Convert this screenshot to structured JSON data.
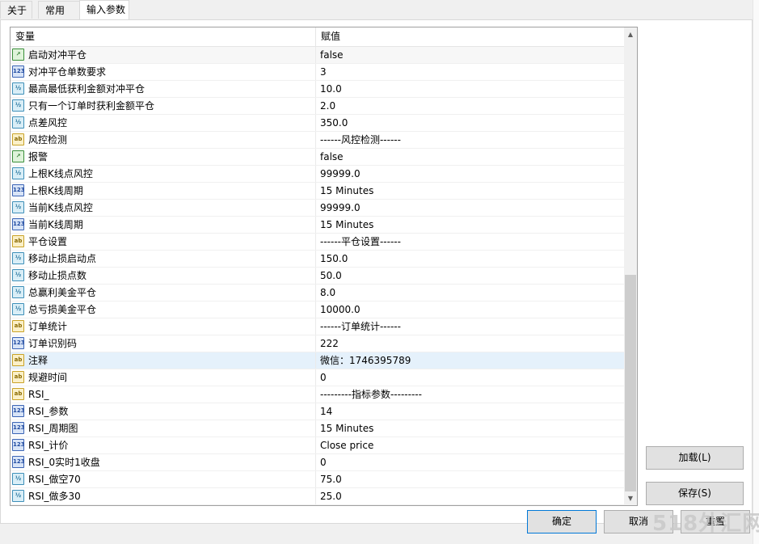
{
  "tabs": [
    "关于",
    "常用",
    "输入参数"
  ],
  "table": {
    "col_variable": "变量",
    "col_value": "赋值",
    "rows": [
      {
        "type": "bool",
        "icon": "boolean-icon",
        "name": "启动对冲平仓",
        "value": "false"
      },
      {
        "type": "int",
        "icon": "integer-icon",
        "name": "对冲平仓单数要求",
        "value": "3"
      },
      {
        "type": "dbl",
        "icon": "double-icon",
        "name": "最高最低获利金额对冲平仓",
        "value": "10.0"
      },
      {
        "type": "dbl",
        "icon": "double-icon",
        "name": "只有一个订单时获利金额平仓",
        "value": "2.0"
      },
      {
        "type": "dbl",
        "icon": "double-icon",
        "name": "点差风控",
        "value": "350.0"
      },
      {
        "type": "str",
        "icon": "string-icon",
        "name": "风控检测",
        "value": "------风控检测------"
      },
      {
        "type": "bool",
        "icon": "boolean-icon",
        "name": "报警",
        "value": "false"
      },
      {
        "type": "dbl",
        "icon": "double-icon",
        "name": "上根K线点风控",
        "value": "99999.0"
      },
      {
        "type": "int",
        "icon": "integer-icon",
        "name": "上根K线周期",
        "value": "15 Minutes"
      },
      {
        "type": "dbl",
        "icon": "double-icon",
        "name": "当前K线点风控",
        "value": "99999.0"
      },
      {
        "type": "int",
        "icon": "integer-icon",
        "name": "当前K线周期",
        "value": "15 Minutes"
      },
      {
        "type": "str",
        "icon": "string-icon",
        "name": "平仓设置",
        "value": "------平仓设置------"
      },
      {
        "type": "dbl",
        "icon": "double-icon",
        "name": "移动止损启动点",
        "value": "150.0"
      },
      {
        "type": "dbl",
        "icon": "double-icon",
        "name": "移动止损点数",
        "value": "50.0"
      },
      {
        "type": "dbl",
        "icon": "double-icon",
        "name": "总赢利美金平仓",
        "value": "8.0"
      },
      {
        "type": "dbl",
        "icon": "double-icon",
        "name": "总亏损美金平仓",
        "value": "10000.0"
      },
      {
        "type": "str",
        "icon": "string-icon",
        "name": "订单统计",
        "value": "------订单统计------"
      },
      {
        "type": "int",
        "icon": "integer-icon",
        "name": "订单识别码",
        "value": "222"
      },
      {
        "type": "str",
        "icon": "string-icon",
        "name": "注释",
        "value": "微信：1746395789",
        "selected": true
      },
      {
        "type": "str",
        "icon": "string-icon",
        "name": "规避时间",
        "value": "0"
      },
      {
        "type": "str",
        "icon": "string-icon",
        "name": "RSI_",
        "value": "---------指标参数---------"
      },
      {
        "type": "int",
        "icon": "integer-icon",
        "name": "RSI_参数",
        "value": "14"
      },
      {
        "type": "int",
        "icon": "integer-icon",
        "name": "RSI_周期图",
        "value": "15 Minutes"
      },
      {
        "type": "int",
        "icon": "integer-icon",
        "name": "RSI_计价",
        "value": "Close price"
      },
      {
        "type": "int",
        "icon": "integer-icon",
        "name": "RSI_0实时1收盘",
        "value": "0"
      },
      {
        "type": "dbl",
        "icon": "double-icon",
        "name": "RSI_做空70",
        "value": "75.0"
      },
      {
        "type": "dbl",
        "icon": "double-icon",
        "name": "RSI_做多30",
        "value": "25.0"
      }
    ]
  },
  "icon_glyphs": {
    "bool": "↗",
    "int": "123",
    "dbl": "½",
    "str": "ab"
  },
  "buttons": {
    "load": "加载(L)",
    "save": "保存(S)",
    "ok": "确定",
    "cancel": "取消",
    "reset": "重置"
  },
  "watermark": "518外汇网"
}
